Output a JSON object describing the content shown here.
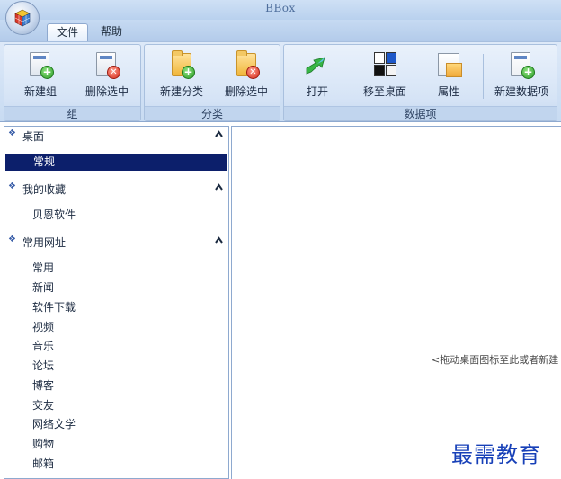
{
  "window": {
    "title": "BBox"
  },
  "tabs": [
    {
      "label": "文件",
      "active": true
    },
    {
      "label": "帮助",
      "active": false
    }
  ],
  "ribbon": {
    "groups": [
      {
        "label": "组",
        "buttons": [
          {
            "label": "新建组",
            "icon": "new-group-icon"
          },
          {
            "label": "删除选中",
            "icon": "delete-group-icon"
          }
        ]
      },
      {
        "label": "分类",
        "buttons": [
          {
            "label": "新建分类",
            "icon": "new-category-icon"
          },
          {
            "label": "删除选中",
            "icon": "delete-category-icon"
          }
        ]
      },
      {
        "label": "数据项",
        "buttons": [
          {
            "label": "打开",
            "icon": "open-arrow-icon"
          },
          {
            "label": "移至桌面",
            "icon": "move-to-desktop-icon"
          },
          {
            "label": "属性",
            "icon": "properties-icon"
          },
          {
            "label": "新建数据项",
            "icon": "new-data-item-icon"
          }
        ]
      }
    ]
  },
  "sidebar": {
    "sections": [
      {
        "title": "桌面",
        "items": [
          "常规"
        ]
      },
      {
        "title": "我的收藏",
        "items": [
          "贝恩软件"
        ]
      },
      {
        "title": "常用网址",
        "items": [
          "常用",
          "新闻",
          "软件下载",
          "视频",
          "音乐",
          "论坛",
          "博客",
          "交友",
          "网络文学",
          "购物",
          "邮箱"
        ]
      }
    ],
    "selected": "常规"
  },
  "content": {
    "hint": "<拖动桌面图标至此或者新建"
  },
  "watermark": "最需教育",
  "colors": {
    "selection": "#0c1f6b",
    "ribbon": "#d6e4f6",
    "accent": "#3a5ea8"
  }
}
